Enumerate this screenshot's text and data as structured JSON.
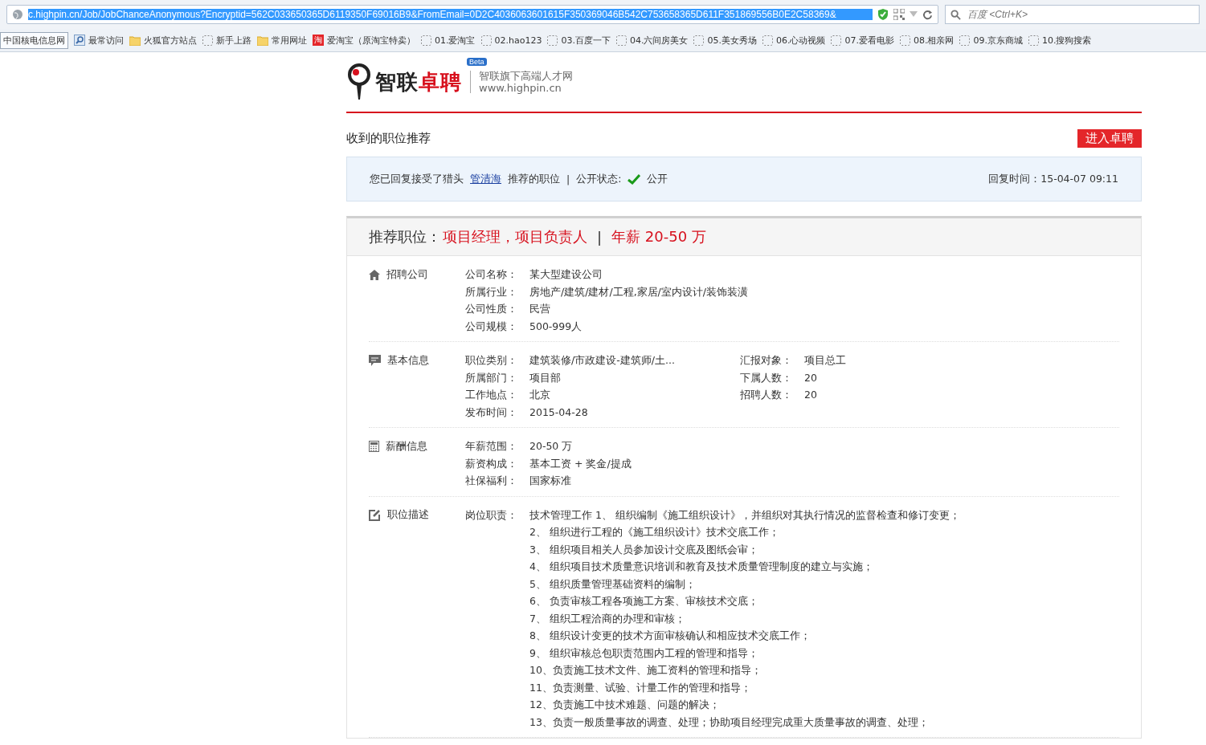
{
  "browser": {
    "url": "c.highpin.cn/Job/JobChanceAnonymous?Encryptid=562C033650365D6119350F69016B9&FromEmail=0D2C4036063601615F350369046B542C753658365D611F351869556B0E2C58369&",
    "search_placeholder": "百度 <Ctrl+K>",
    "bookmarks": [
      {
        "kind": "button",
        "label": "中国核电信息网"
      },
      {
        "kind": "search",
        "label": "最常访问"
      },
      {
        "kind": "folder",
        "label": "火狐官方站点"
      },
      {
        "kind": "page",
        "label": "新手上路"
      },
      {
        "kind": "folder",
        "label": "常用网址"
      },
      {
        "kind": "taobao",
        "label": "爱淘宝（原淘宝特卖）",
        "icon_text": "淘"
      },
      {
        "kind": "page",
        "label": "01.爱淘宝"
      },
      {
        "kind": "page",
        "label": "02.hao123"
      },
      {
        "kind": "page",
        "label": "03.百度一下"
      },
      {
        "kind": "page",
        "label": "04.六间房美女"
      },
      {
        "kind": "page",
        "label": "05.美女秀场"
      },
      {
        "kind": "page",
        "label": "06.心动视频"
      },
      {
        "kind": "page",
        "label": "07.爱看电影"
      },
      {
        "kind": "page",
        "label": "08.相亲网"
      },
      {
        "kind": "page",
        "label": "09.京东商城"
      },
      {
        "kind": "page",
        "label": "10.搜狗搜索"
      }
    ]
  },
  "logo": {
    "name_black": "智联",
    "name_red": "卓聘",
    "badge": "Beta",
    "tagline": "智联旗下高端人才网",
    "site": "www.highpin.cn"
  },
  "page_title": "收到的职位推荐",
  "enter_button": "进入卓聘",
  "notice": {
    "text_before": "您已回复接受了猎头",
    "hunter_link": "管清海",
    "text_after": "推荐的职位",
    "separator": "|",
    "status_label": "公开状态:",
    "public": true,
    "status_value": "公开",
    "reply_label": "回复时间：",
    "reply_time": "15-04-07 09:11"
  },
  "job": {
    "label": "推荐职位：",
    "title": "项目经理，项目负责人",
    "separator": "|",
    "salary": "年薪 20-50 万"
  },
  "sections": [
    {
      "kind": "company",
      "title": "招聘公司",
      "rows": [
        {
          "label": "公司名称：",
          "value": "某大型建设公司"
        },
        {
          "label": "所属行业：",
          "value": "房地产/建筑/建材/工程,家居/室内设计/装饰装潢"
        },
        {
          "label": "公司性质：",
          "value": "民营"
        },
        {
          "label": "公司规模：",
          "value": "500-999人"
        }
      ]
    },
    {
      "kind": "basic",
      "title": "基本信息",
      "rows": [
        {
          "label": "职位类别：",
          "value": "建筑装修/市政建设-建筑师/土..."
        },
        {
          "label": "所属部门：",
          "value": "项目部"
        },
        {
          "label": "工作地点：",
          "value": "北京"
        },
        {
          "label": "发布时间：",
          "value": "2015-04-28"
        }
      ],
      "side_rows": [
        {
          "label": "汇报对象：",
          "value": "项目总工"
        },
        {
          "label": "下属人数：",
          "value": "20"
        },
        {
          "label": "招聘人数：",
          "value": "20"
        }
      ]
    },
    {
      "kind": "salary",
      "title": "薪酬信息",
      "rows": [
        {
          "label": "年薪范围：",
          "value": "20-50 万"
        },
        {
          "label": "薪资构成：",
          "value": "基本工资 + 奖金/提成"
        },
        {
          "label": "社保福利：",
          "value": "国家标准"
        }
      ]
    },
    {
      "kind": "description",
      "title": "职位描述",
      "rows": [
        {
          "label": "岗位职责：",
          "value": "技术管理工作 1、 组织编制《施工组织设计》，并组织对其执行情况的监督检查和修订变更；",
          "lines": [
            "2、 组织进行工程的《施工组织设计》技术交底工作；",
            "3、 组织项目相关人员参加设计交底及图纸会审；",
            "4、 组织项目技术质量意识培训和教育及技术质量管理制度的建立与实施；",
            "5、 组织质量管理基础资料的编制；",
            "6、 负责审核工程各项施工方案、审核技术交底；",
            "7、 组织工程洽商的办理和审核；",
            "8、 组织设计变更的技术方面审核确认和相应技术交底工作；",
            "9、 组织审核总包职责范围内工程的管理和指导；",
            "10、负责施工技术文件、施工资料的管理和指导；",
            "11、负责测量、试验、计量工作的管理和指导；",
            "12、负责施工中技术难题、问题的解决；",
            "13、负责一般质量事故的调查、处理；协助项目经理完成重大质量事故的调查、处理；"
          ]
        }
      ]
    }
  ]
}
